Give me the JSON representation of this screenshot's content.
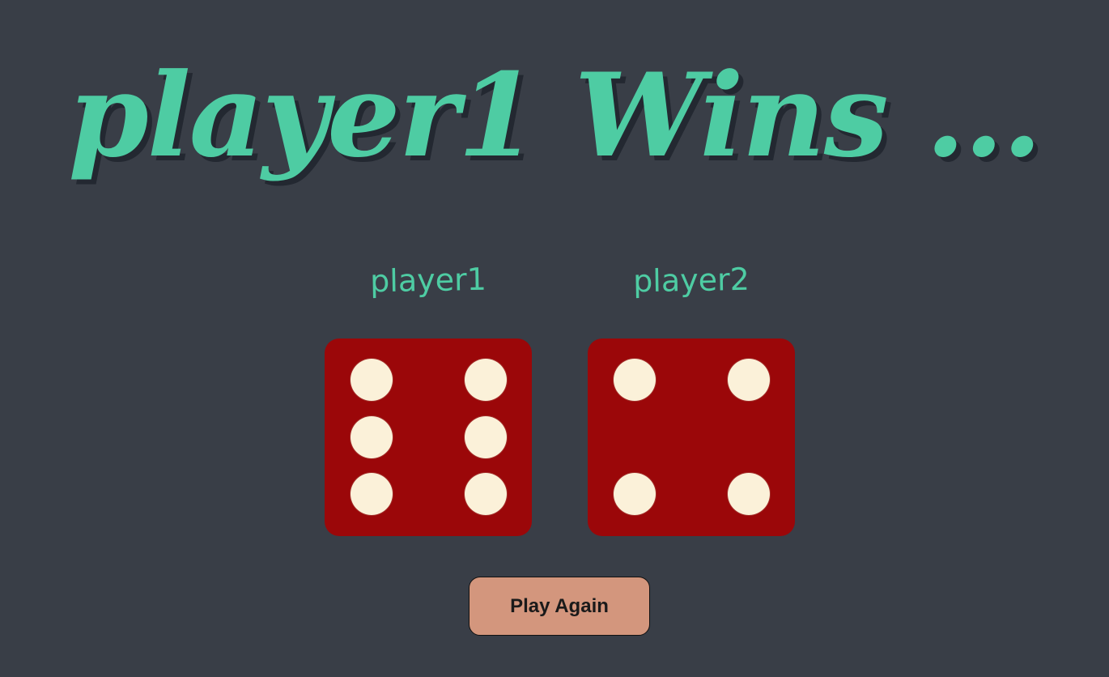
{
  "game": {
    "title": "player1 Wins ...",
    "play_again_label": "Play Again"
  },
  "players": [
    {
      "label": "player1",
      "die_value": 6
    },
    {
      "label": "player2",
      "die_value": 4
    }
  ],
  "colors": {
    "background": "#393e47",
    "accent": "#4ecca3",
    "die": "#9b0709",
    "pip": "#fbf1d9",
    "button": "#d3967d"
  }
}
